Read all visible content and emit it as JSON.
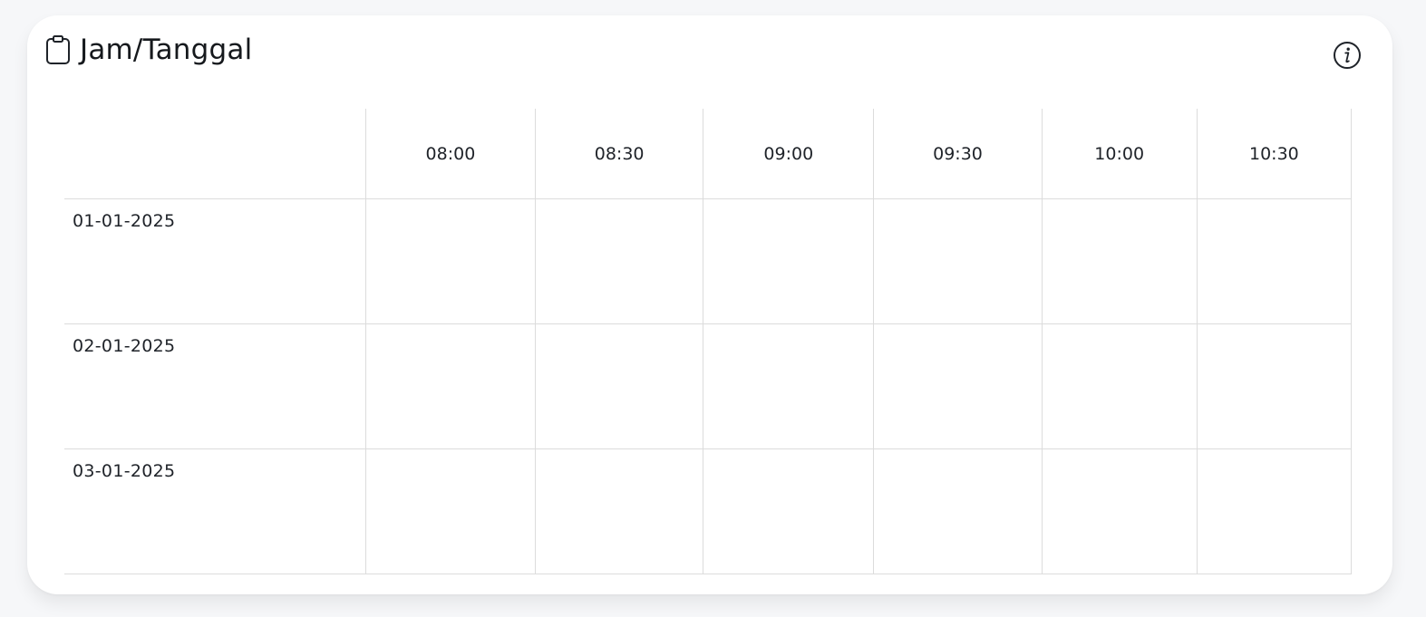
{
  "header": {
    "title": "Jam/Tanggal",
    "title_icon": "clipboard-icon",
    "info_icon": "info-icon"
  },
  "schedule": {
    "times": [
      "08:00",
      "08:30",
      "09:00",
      "09:30",
      "10:00",
      "10:30"
    ],
    "dates": [
      "01-01-2025",
      "02-01-2025",
      "03-01-2025"
    ]
  },
  "colors": {
    "background": "#f6f7f9",
    "card": "#ffffff",
    "grid_line": "#dcdcdc",
    "text": "#1f2329"
  }
}
